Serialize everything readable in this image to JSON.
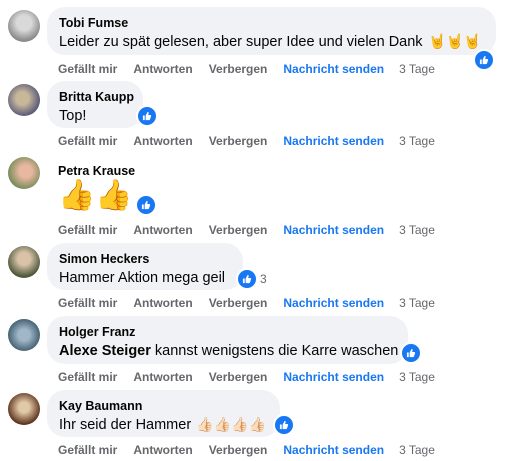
{
  "actions": {
    "like": "Gefällt mir",
    "reply": "Antworten",
    "hide": "Verbergen",
    "message": "Nachricht senden"
  },
  "colors": {
    "bubble": "#f0f2f5",
    "like_blue": "#1877f2",
    "muted": "#65676b"
  },
  "comments": [
    {
      "author": "Tobi Fumse",
      "text": "Leider zu spät gelesen, aber super Idee und vielen Dank",
      "emoji": "🤘🤘🤘",
      "reaction_icon": "like-icon",
      "time": "3 Tage"
    },
    {
      "author": "Britta Kaupp",
      "text": "Top!",
      "reaction_icon": "like-icon",
      "time": "3 Tage"
    },
    {
      "author": "Petra Krause",
      "emoji": "👍👍",
      "reaction_icon": "like-icon",
      "time": "3 Tage"
    },
    {
      "author": "Simon Heckers",
      "text": "Hammer Aktion mega geil",
      "reaction_icon": "like-icon",
      "reaction_count": "3",
      "time": "3 Tage"
    },
    {
      "author": "Holger Franz",
      "mention": "Alexe Steiger",
      "text": "kannst wenigstens die Karre waschen",
      "reaction_icon": "like-icon",
      "time": "3 Tage"
    },
    {
      "author": "Kay Baumann",
      "text": "Ihr seid der Hammer",
      "emoji": "👍🏻👍🏻👍🏻👍🏻",
      "reaction_icon": "like-icon",
      "time": "3 Tage"
    }
  ]
}
